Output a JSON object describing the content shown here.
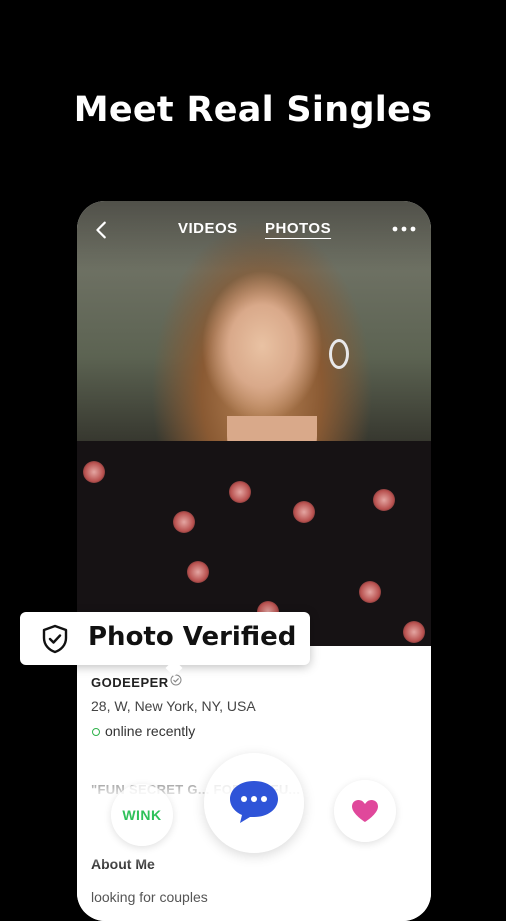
{
  "headline": "Meet Real Singles",
  "profile_header": {
    "tabs": [
      "VIDEOS",
      "PHOTOS"
    ],
    "active_tab": "PHOTOS",
    "back_icon": "chevron-left-icon",
    "more_icon": "more-dots-icon"
  },
  "verified_badge": {
    "label": "Photo Verified",
    "icon": "shield-check-icon"
  },
  "profile": {
    "username": "GODEEPER",
    "details": "28, W, New York, NY, USA",
    "status": "online recently",
    "bio_heading": "\"FUN SECRET G... FOR A... FU...",
    "about_title": "About Me",
    "about_text": "looking for couples"
  },
  "actions": {
    "wink_label": "WINK",
    "chat_icon": "chat-bubble-icon",
    "like_icon": "heart-icon"
  },
  "colors": {
    "background": "#000000",
    "online": "#2fb24a",
    "wink": "#2fc15a",
    "chat": "#2f54d8",
    "heart": "#e0489b"
  }
}
